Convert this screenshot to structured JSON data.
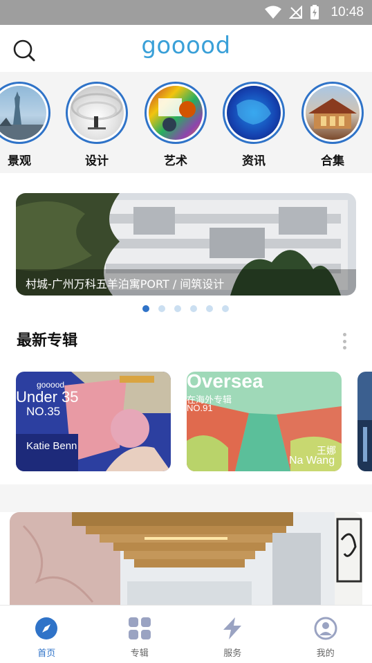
{
  "status_bar": {
    "time": "10:48"
  },
  "header": {
    "logo": "gooood"
  },
  "categories": [
    {
      "label": "景观"
    },
    {
      "label": "设计"
    },
    {
      "label": "艺术"
    },
    {
      "label": "资讯"
    },
    {
      "label": "合集"
    }
  ],
  "banner": {
    "caption": "村城-广州万科五羊泊寓PORT / 间筑设计"
  },
  "carousel": {
    "page_count": 6,
    "active_index": 0
  },
  "albums_section": {
    "title": "最新专辑"
  },
  "albums": [
    {
      "brand": "gooood",
      "title": "Under 35",
      "number": "NO.35",
      "author": "Katie Benn"
    },
    {
      "title": "Oversea",
      "subtitle": "在海外专辑",
      "number": "NO.91",
      "author_cn": "王娜",
      "author_en": "Na Wang"
    }
  ],
  "bottom_nav": [
    {
      "label": "首页",
      "icon": "compass-icon",
      "active": true
    },
    {
      "label": "专辑",
      "icon": "grid-icon",
      "active": false
    },
    {
      "label": "服务",
      "icon": "lightning-icon",
      "active": false
    },
    {
      "label": "我的",
      "icon": "user-icon",
      "active": false
    }
  ],
  "colors": {
    "accent": "#2f73c8",
    "logo": "#3aa0d8",
    "status_bar": "#9e9e9e"
  }
}
